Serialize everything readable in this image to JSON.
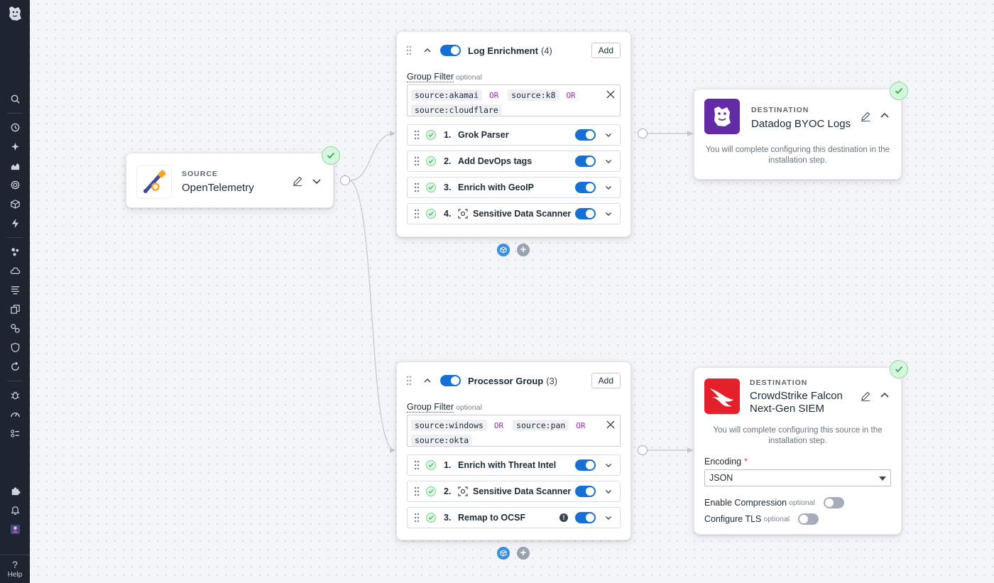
{
  "nav": {
    "help_label": "Help"
  },
  "source": {
    "kicker": "SOURCE",
    "name": "OpenTelemetry"
  },
  "groups": [
    {
      "title": "Log Enrichment",
      "count": "(4)",
      "add_label": "Add",
      "filter_label": "Group Filter",
      "filter_optional": "optional",
      "filter_tokens": [
        {
          "key": "source",
          "val": "akamai"
        },
        {
          "key": "source",
          "val": "k8"
        },
        {
          "key": "source",
          "val": "cloudflare"
        }
      ],
      "operator": "OR",
      "processors": [
        {
          "num": "1.",
          "name": "Grok Parser"
        },
        {
          "num": "2.",
          "name": "Add DevOps tags"
        },
        {
          "num": "3.",
          "name": "Enrich with GeoIP"
        },
        {
          "num": "4.",
          "name": "Sensitive Data Scanner"
        }
      ]
    },
    {
      "title": "Processor Group",
      "count": "(3)",
      "add_label": "Add",
      "filter_label": "Group Filter",
      "filter_optional": "optional",
      "filter_tokens": [
        {
          "key": "source",
          "val": "windows"
        },
        {
          "key": "source",
          "val": "pan"
        },
        {
          "key": "source",
          "val": "okta"
        }
      ],
      "operator": "OR",
      "processors": [
        {
          "num": "1.",
          "name": "Enrich with Threat Intel"
        },
        {
          "num": "2.",
          "name": "Sensitive Data Scanner"
        },
        {
          "num": "3.",
          "name": "Remap to OCSF"
        }
      ]
    }
  ],
  "destinations": [
    {
      "kicker": "DESTINATION",
      "name": "Datadog BYOC Logs",
      "note": "You will complete configuring this destination in the installation step."
    },
    {
      "kicker": "DESTINATION",
      "name_line1": "CrowdStrike Falcon",
      "name_line2": "Next-Gen SIEM",
      "note": "You will complete configuring this source in the installation step.",
      "encoding_label": "Encoding",
      "encoding_required": "*",
      "encoding_value": "JSON",
      "compression_label": "Enable Compression",
      "compression_optional": "optional",
      "tls_label": "Configure TLS",
      "tls_optional": "optional"
    }
  ],
  "colors": {
    "accent": "#1670d6",
    "nav_bg": "#1e2430",
    "success": "#3fb55a",
    "crowdstrike": "#e4202a",
    "datadog": "#632ca6"
  }
}
